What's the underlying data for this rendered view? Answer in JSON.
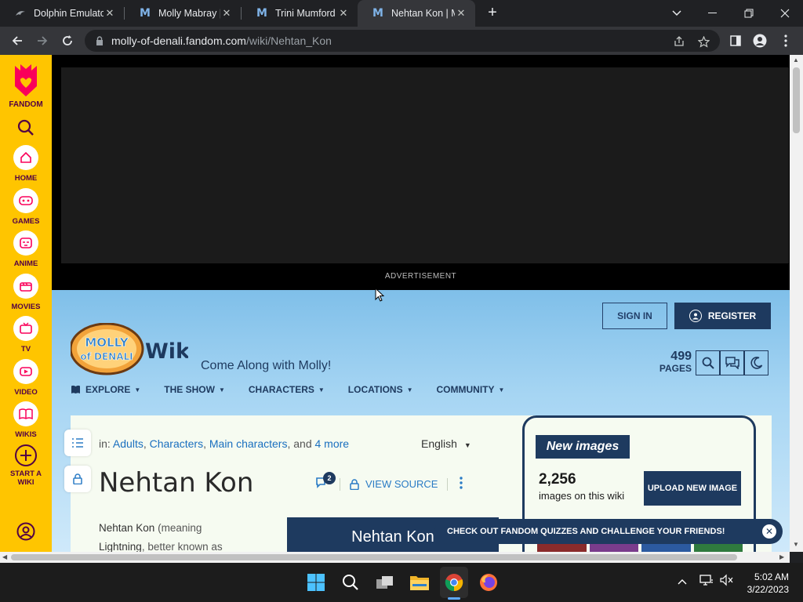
{
  "browser": {
    "tabs": [
      {
        "title": "Dolphin Emulato",
        "icon": "dolphin-icon"
      },
      {
        "title": "Molly Mabray | M",
        "icon": "fandom-m-icon"
      },
      {
        "title": "Trini Mumford | M",
        "icon": "fandom-m-icon"
      },
      {
        "title": "Nehtan Kon | Mo",
        "icon": "fandom-m-icon",
        "active": true
      }
    ],
    "url_host": "molly-of-denali.fandom.com",
    "url_path": "/wiki/Nehtan_Kon"
  },
  "fandom_rail": {
    "brand": "FANDOM",
    "items": [
      {
        "label": "HOME",
        "icon": "home-icon"
      },
      {
        "label": "GAMES",
        "icon": "gamepad-icon"
      },
      {
        "label": "ANIME",
        "icon": "anime-icon"
      },
      {
        "label": "MOVIES",
        "icon": "movie-icon"
      },
      {
        "label": "TV",
        "icon": "tv-icon"
      },
      {
        "label": "VIDEO",
        "icon": "video-icon"
      },
      {
        "label": "WIKIS",
        "icon": "book-icon"
      },
      {
        "label": "START A WIKI",
        "icon": "plus-icon"
      }
    ]
  },
  "ad": {
    "label": "ADVERTISEMENT"
  },
  "wiki": {
    "sign_in": "SIGN IN",
    "register": "REGISTER",
    "logo_text": "MOLLY of DENALI",
    "logo_wiki": "Wiki",
    "tagline": "Come Along with Molly!",
    "pages_count": "499",
    "pages_label": "PAGES",
    "nav": [
      "EXPLORE",
      "THE SHOW",
      "CHARACTERS",
      "LOCATIONS",
      "COMMUNITY"
    ]
  },
  "article": {
    "in_label": "in:",
    "categories": [
      "Adults",
      "Characters",
      "Main characters"
    ],
    "and_label": ", and",
    "more": "4 more",
    "language": "English",
    "title": "Nehtan Kon",
    "comment_count": "2",
    "view_source": "VIEW SOURCE",
    "intro_name": "Nehtan Kon",
    "intro_rest": "(meaning",
    "intro_line2_hl": "Lightning",
    "intro_line2": ", better known as",
    "infobox_title": "Nehtan Kon"
  },
  "rail": {
    "module_title": "New images",
    "image_count": "2,256",
    "image_sub": "images on this wiki",
    "upload": "UPLOAD NEW IMAGE"
  },
  "toast": {
    "text": "CHECK OUT FANDOM QUIZZES AND CHALLENGE YOUR FRIENDS!"
  },
  "taskbar": {
    "time": "5:02 AM",
    "date": "3/22/2023"
  },
  "colors": {
    "fandom_yellow": "#ffc500",
    "fandom_pink": "#fa005a",
    "wiki_navy": "#1e3a5f",
    "link_blue": "#1a6fbf"
  }
}
